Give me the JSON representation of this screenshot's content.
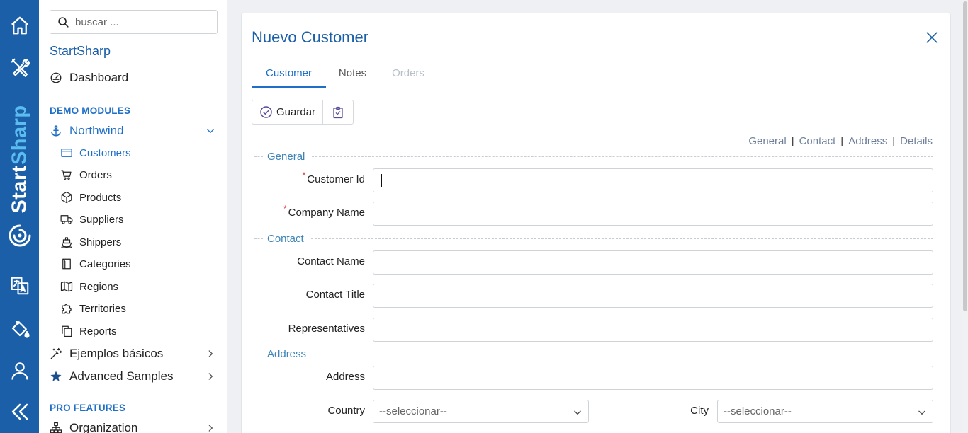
{
  "rail": {
    "brand_start": "Start",
    "brand_sharp": "Sharp"
  },
  "sidebar": {
    "search_placeholder": "buscar ...",
    "app_name": "StartSharp",
    "dashboard": "Dashboard",
    "demo_header": "DEMO MODULES",
    "northwind": "Northwind",
    "items": [
      "Customers",
      "Orders",
      "Products",
      "Suppliers",
      "Shippers",
      "Categories",
      "Regions",
      "Territories",
      "Reports"
    ],
    "basic": "Ejemplos básicos",
    "advanced": "Advanced Samples",
    "pro_header": "PRO FEATURES",
    "organization": "Organization"
  },
  "dialog": {
    "title": "Nuevo Customer",
    "tabs": [
      "Customer",
      "Notes",
      "Orders"
    ],
    "save_label": "Guardar",
    "jumps": [
      "General",
      "Contact",
      "Address",
      "Details"
    ],
    "categories": {
      "general": "General",
      "contact": "Contact",
      "address": "Address"
    },
    "fields": {
      "customer_id": "Customer Id",
      "company_name": "Company Name",
      "contact_name": "Contact Name",
      "contact_title": "Contact Title",
      "representatives": "Representatives",
      "address": "Address",
      "country": "Country",
      "city": "City"
    },
    "select_placeholder": "--seleccionar--"
  },
  "colors": {
    "rail": "#1a5fa8",
    "accent": "#1f6fc7",
    "category": "#3d84b8"
  }
}
